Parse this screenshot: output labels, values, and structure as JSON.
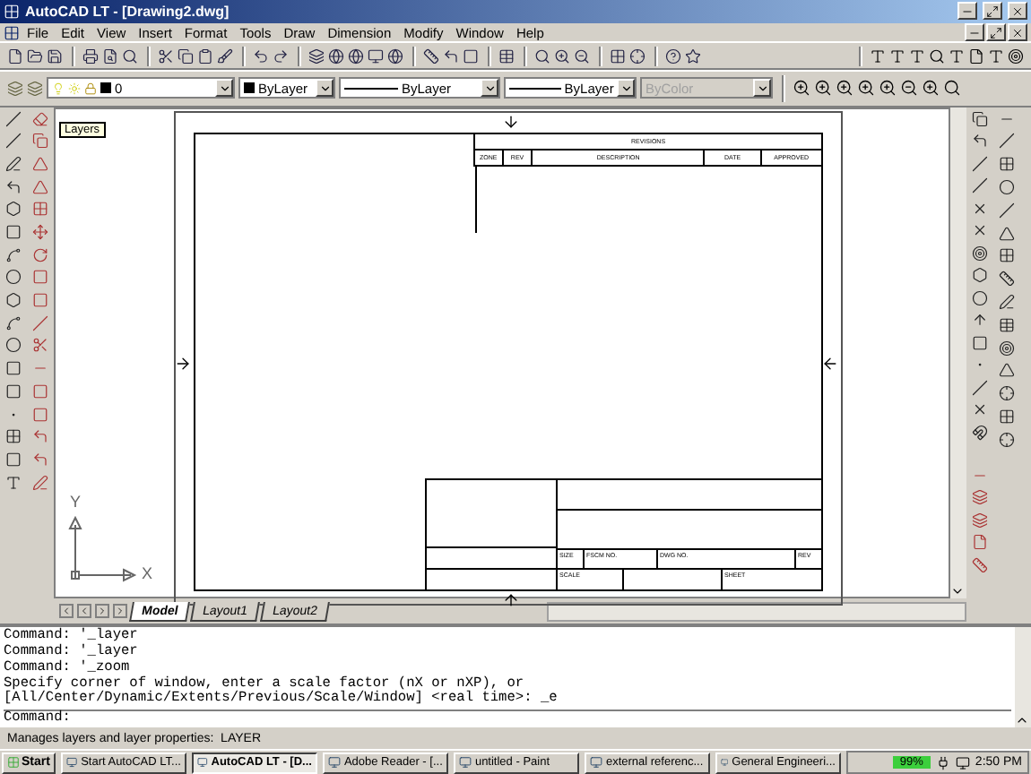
{
  "window": {
    "title": "AutoCAD LT - [Drawing2.dwg]"
  },
  "menu": [
    "File",
    "Edit",
    "View",
    "Insert",
    "Format",
    "Tools",
    "Draw",
    "Dimension",
    "Modify",
    "Window",
    "Help"
  ],
  "properties_bar": {
    "layer": "0",
    "color_setting": "ByLayer",
    "linetype": "ByLayer",
    "lineweight": "ByLayer",
    "plot_style": {
      "value": "ByColor",
      "disabled": true
    }
  },
  "tooltip": "Layers",
  "title_block": {
    "revisions_heading": "REVISIONS",
    "revision_columns": [
      "ZONE",
      "REV",
      "DESCRIPTION",
      "DATE",
      "APPROVED"
    ],
    "size_label": "SIZE",
    "fscm_label": "FSCM NO.",
    "dwg_label": "DWG NO.",
    "rev_label": "REV",
    "scale_label": "SCALE",
    "sheet_label": "SHEET"
  },
  "ucs": {
    "y_label": "Y",
    "x_label": "X"
  },
  "layout_tabs": [
    {
      "label": "Model",
      "selected": true
    },
    {
      "label": "Layout1",
      "selected": false
    },
    {
      "label": "Layout2",
      "selected": false
    }
  ],
  "command_history": [
    "Command: '_layer",
    "Command: '_layer",
    "Command: '_zoom",
    "Specify corner of window, enter a scale factor (nX or nXP), or",
    "[All/Center/Dynamic/Extents/Previous/Scale/Window] <real time>: _e"
  ],
  "command_prompt": "Command:",
  "status_text": "Manages layers and layer properties:  LAYER",
  "taskbar": {
    "start": "Start",
    "tasks": [
      {
        "label": "Start AutoCAD LT...",
        "selected": false
      },
      {
        "label": "AutoCAD LT - [D...",
        "selected": true
      },
      {
        "label": "Adobe Reader - [...",
        "selected": false
      },
      {
        "label": "untitled - Paint",
        "selected": false
      },
      {
        "label": "external referenc...",
        "selected": false
      },
      {
        "label": "General Engineeri...",
        "selected": false
      }
    ],
    "battery": "99%",
    "clock": "2:50 PM"
  }
}
